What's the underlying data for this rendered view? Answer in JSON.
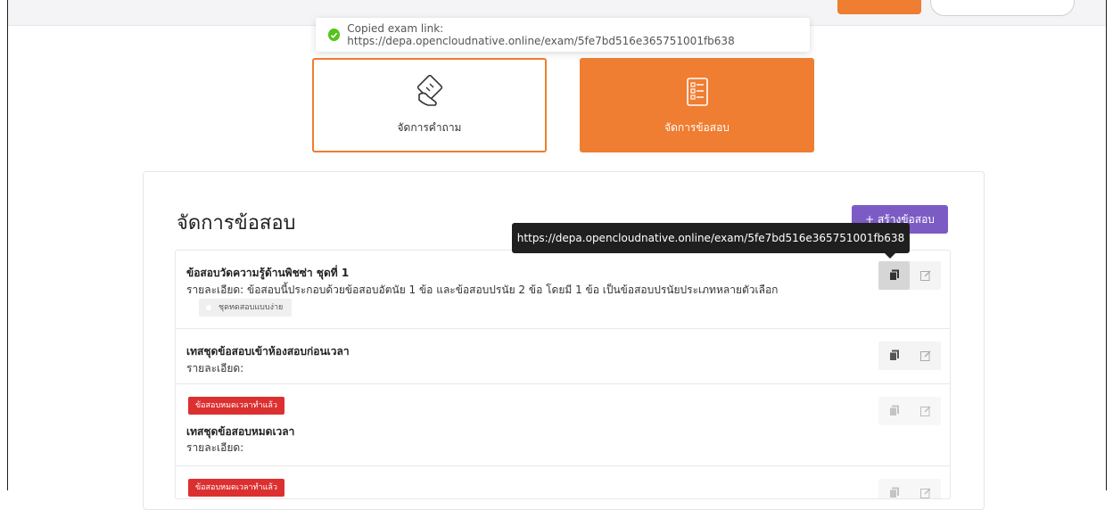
{
  "toast": {
    "message": "Copied exam link: https://depa.opencloudnative.online/exam/5fe7bd516e365751001fb638"
  },
  "nav": {
    "questions_label": "จัดการคำถาม",
    "exams_label": "จัดการข้อสอบ"
  },
  "panel": {
    "title": "จัดการข้อสอบ",
    "create_label": "+ สร้างข้อสอบ"
  },
  "tooltip": {
    "text": "https://depa.opencloudnative.online/exam/5fe7bd516e365751001fb638"
  },
  "exams": [
    {
      "title": "ข้อสอบวัดความรู้ด้านพิชซ่า ชุดที่ 1",
      "detail": "รายละเอียด: ข้อสอบนี้ประกอบด้วยข้อสอบอัตนัย 1 ข้อ และข้อสอบปรนัย 2 ข้อ โดยมี 1 ข้อ เป็นข้อสอบปรนัยประเภทหลายตัวเลือก",
      "tag": "ชุดทดสอบแบบง่าย"
    },
    {
      "title": "เทสชุดข้อสอบเข้าห้องสอบก่อนเวลา",
      "detail": "รายละเอียด:"
    },
    {
      "badge": "ข้อสอบหมดเวลาทำแล้ว",
      "title": "เทสชุดข้อสอบหมดเวลา",
      "detail": "รายละเอียด:"
    },
    {
      "badge": "ข้อสอบหมดเวลาทำแล้ว"
    }
  ],
  "colors": {
    "accent_orange": "#ef7d32",
    "create_purple": "#7c5cc4",
    "expired_red": "#dc3030",
    "success_green": "#52c41a"
  },
  "icons": {
    "toast": "check-circle-icon",
    "questions": "hand-touch-icon",
    "exams": "checklist-document-icon",
    "copy": "copy-icon",
    "edit": "edit-icon"
  }
}
